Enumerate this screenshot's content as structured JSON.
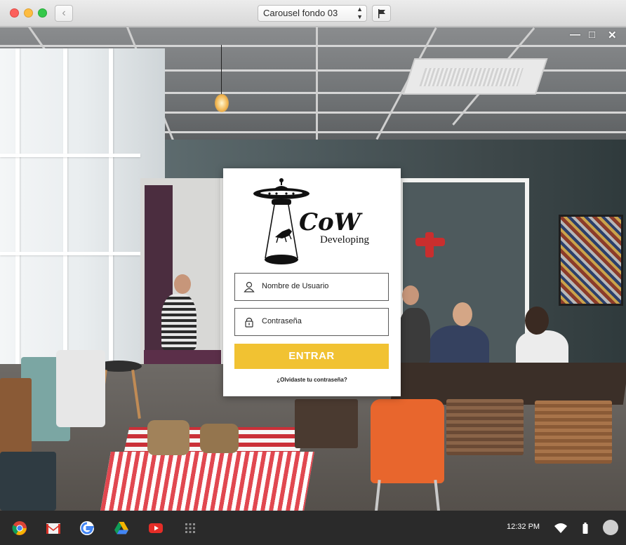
{
  "window": {
    "tab_selector_value": "Carousel fondo 03",
    "back_icon": "chevron-left-icon",
    "flag_icon": "flag-icon"
  },
  "app_controls": {
    "minimize": "—",
    "maximize": "□",
    "close": "✕"
  },
  "login": {
    "logo_text": "CoW",
    "logo_subtext": "Developing",
    "username_placeholder": "Nombre de Usuario",
    "password_placeholder": "Contraseña",
    "submit_label": "ENTRAR",
    "forgot_link": "¿Olvidaste tu contraseña?",
    "accent_color": "#f1c232"
  },
  "shelf": {
    "apps": [
      "chrome-icon",
      "gmail-icon",
      "google-icon",
      "drive-icon",
      "youtube-icon",
      "app-launcher-icon"
    ],
    "time": "12:32 PM",
    "status_icons": [
      "wifi-icon",
      "battery-icon",
      "account-avatar"
    ]
  }
}
